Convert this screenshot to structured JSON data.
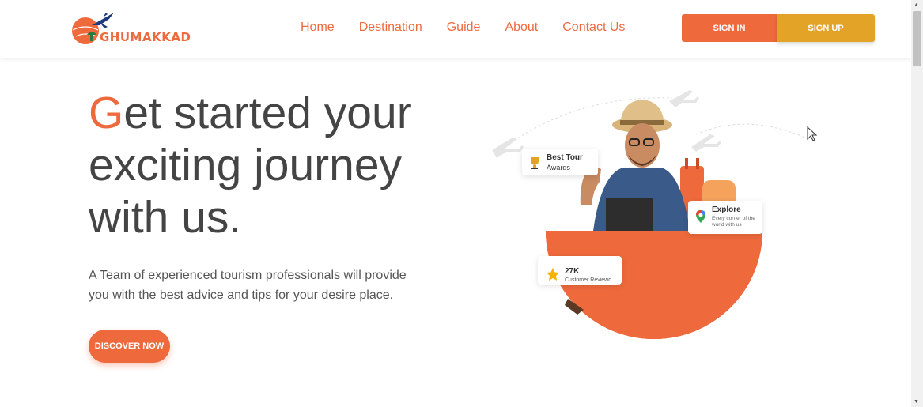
{
  "header": {
    "logo_text": "GHUMAKKAD",
    "nav": [
      "Home",
      "Destination",
      "Guide",
      "About",
      "Contact Us"
    ],
    "signin_label": "SIGN IN",
    "signup_label": "SIGN UP"
  },
  "hero": {
    "title_first_letter": "G",
    "title_rest_line1": "et started your",
    "title_line2": "exciting journey",
    "title_line3": "with us.",
    "description": "A Team of experienced tourism professionals will provide you with the best advice and tips for your desire place.",
    "cta_label": "DISCOVER NOW"
  },
  "cards": {
    "awards_title": "Best Tour",
    "awards_sub": "Awards",
    "explore_title": "Explore",
    "explore_sub": "Every corner of the world with us",
    "reviews_count": "27K",
    "reviews_sub": "Customer Reviewd"
  },
  "colors": {
    "accent": "#ee6a3c",
    "secondary": "#e3a327",
    "text": "#444444"
  }
}
